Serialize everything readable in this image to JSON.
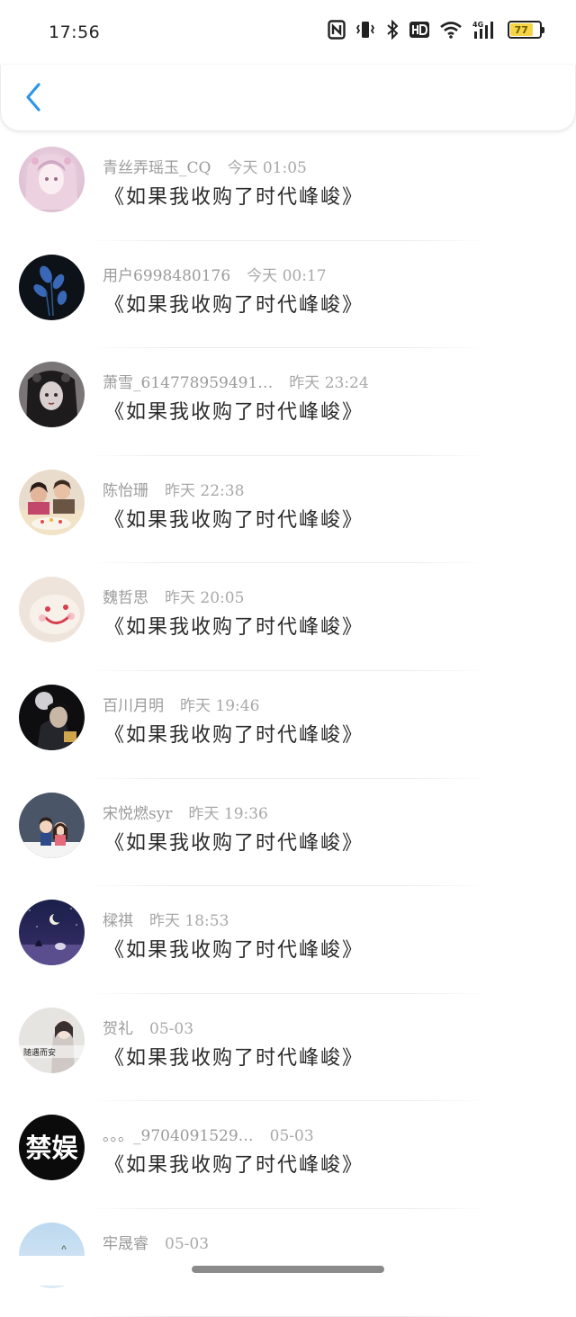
{
  "status_bar": {
    "time": "17:56",
    "battery_level": "77",
    "icons": [
      "nfc-icon",
      "vibrate-icon",
      "bluetooth-icon",
      "hd-icon",
      "wifi-icon",
      "signal-4g-icon",
      "battery-icon"
    ]
  },
  "nav": {
    "back_icon": "chevron-left-icon",
    "accent": "#2f95e8"
  },
  "list": [
    {
      "name": "青丝弄瑶玉_CQ",
      "time": "今天 01:05",
      "message": "《如果我收购了时代峰峻》",
      "avatar": "anime-girl-pink"
    },
    {
      "name": "用户6998480176",
      "time": "今天 00:17",
      "message": "《如果我收购了时代峰峻》",
      "avatar": "blue-flowers-dark"
    },
    {
      "name": "萧雪_614778959491…",
      "time": "昨天 23:24",
      "message": "《如果我收购了时代峰峻》",
      "avatar": "gothic-girl"
    },
    {
      "name": "陈怡珊",
      "time": "昨天 22:38",
      "message": "《如果我收购了时代峰峻》",
      "avatar": "group-photo-cake"
    },
    {
      "name": "魏哲思",
      "time": "昨天 20:05",
      "message": "《如果我收购了时代峰峻》",
      "avatar": "smiley-cookie"
    },
    {
      "name": "百川月明",
      "time": "昨天 19:46",
      "message": "《如果我收购了时代峰峻》",
      "avatar": "dark-boy-portrait"
    },
    {
      "name": "宋悦燃syr",
      "time": "昨天 19:36",
      "message": "《如果我收购了时代峰峻》",
      "avatar": "cartoon-couple"
    },
    {
      "name": "樑祺",
      "time": "昨天 18:53",
      "message": "《如果我收购了时代峰峻》",
      "avatar": "moon-night-girl"
    },
    {
      "name": "贺礼",
      "time": "05-03",
      "message": "《如果我收购了时代峰峻》",
      "avatar": "girl-caption",
      "avatar_caption": "随遇而安"
    },
    {
      "name": "。。。_9704091529…",
      "time": "05-03",
      "message": "《如果我收购了时代峰峻》",
      "avatar": "text-badge",
      "avatar_text": "禁娱"
    },
    {
      "name": "牢晟睿",
      "time": "05-03",
      "message": "",
      "avatar": "sky-blue"
    }
  ]
}
